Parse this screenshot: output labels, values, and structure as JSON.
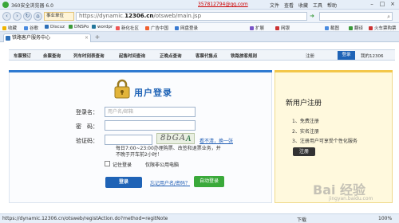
{
  "browser": {
    "title": "360安全浏览器 6.0",
    "user": "357812794@qq.com",
    "menu": [
      "文件",
      "查看",
      "收藏",
      "工具",
      "帮助"
    ],
    "address": {
      "badge": "事业单位",
      "url_prefix": "https://dynamic.",
      "url_domain": "12306.cn",
      "url_suffix": "/otsweb/main.jsp"
    },
    "search_placeholder": "",
    "bookmarks": [
      "收藏",
      "谷歌",
      "Discuz",
      "DNSPo",
      "wordpr",
      "新化社区",
      "广告中国",
      "网盘登录",
      "扩展",
      "网银",
      "截图",
      "翻译",
      "火车票购票"
    ],
    "tab": {
      "title": "铁路客户服务中心"
    },
    "status": {
      "url": "https://dynamic.12306.cn/otsweb/registAction.do?method=regitNote",
      "download": "下载",
      "zoom": "100%"
    }
  },
  "site": {
    "nav": [
      "车票预订",
      "余票查询",
      "列车时刻表查询",
      "起售时间查询",
      "正晚点查询",
      "客票代售点",
      "铁路旅客规则"
    ],
    "register": "注册",
    "login": "登录",
    "my12306": "我的12306"
  },
  "login": {
    "title": "用户登录",
    "username_label": "登录名：",
    "username_placeholder": "用户名/邮箱",
    "password_label": "密　码：",
    "captcha_label": "验证码：",
    "captcha_text": "8bGA",
    "captcha_mark": "A",
    "refresh_link": "看不清，换一张",
    "notice": "每日7:00~23:00办理购票、改签和退票业务，并不晚于开车前2小时！",
    "remember_label": "记住登录",
    "remember_note": "仅限非公用电脑",
    "login_button": "登录",
    "forgot_link": "忘记用户名/密码？",
    "auto_login_button": "自动登录"
  },
  "register": {
    "title": "新用户注册",
    "steps": [
      "1、免费注册",
      "2、实名注册",
      "3、注册用户可享受个性化服务"
    ],
    "button": "注册"
  },
  "watermark": {
    "text": "Bai 经验",
    "sub": "jingyan.baidu.com"
  }
}
